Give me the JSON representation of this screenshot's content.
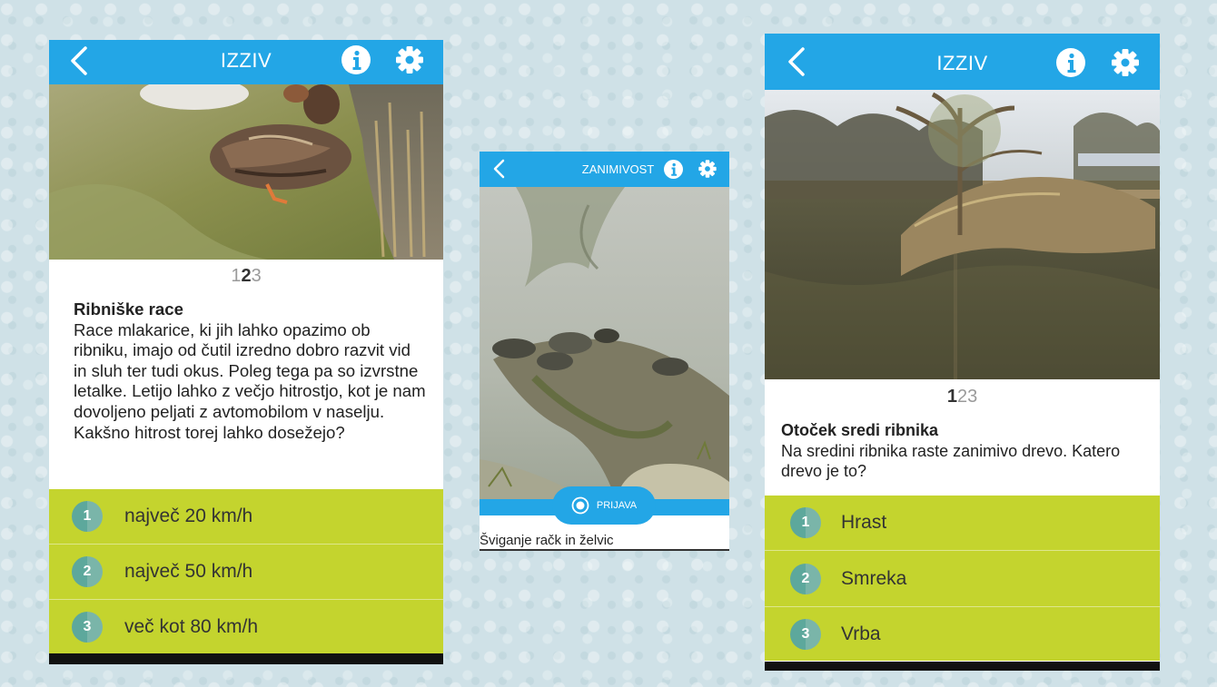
{
  "screens": {
    "left": {
      "header_title": "IZZIV",
      "pager": [
        "1",
        "2",
        "3"
      ],
      "pager_current": "2",
      "description_title": "Ribniške race",
      "description_text": "Race mlakarice, ki jih lahko opazimo ob ribniku, imajo od čutil izredno dobro razvit vid in sluh ter tudi okus. Poleg tega pa so izvrstne letalke. Letijo lahko z večjo hitrostjo, kot je nam dovoljeno peljati z avtomobilom v naselju. Kakšno hitrost torej lahko dosežejo?",
      "answers": [
        {
          "num": "1",
          "label": "največ 20 km/h"
        },
        {
          "num": "2",
          "label": "največ 50 km/h"
        },
        {
          "num": "3",
          "label": "več kot 80 km/h"
        }
      ]
    },
    "middle": {
      "header_title": "ZANIMIVOST",
      "checkin_label": "PRIJAVA",
      "caption": "Švigan​je račk in želvic"
    },
    "right": {
      "header_title": "IZZIV",
      "pager": [
        "1",
        "2",
        "3"
      ],
      "pager_current": "1",
      "description_title": "Otoček sredi ribnika",
      "description_text": "Na sredini ribnika raste zanimivo drevo. Katero drevo je to?",
      "answers": [
        {
          "num": "1",
          "label": "Hrast"
        },
        {
          "num": "2",
          "label": "Smreka"
        },
        {
          "num": "3",
          "label": "Vrba"
        }
      ]
    }
  },
  "colors": {
    "header": "#23a6e6",
    "answers_bg": "#c4d42e",
    "number_badge": "#5da89c",
    "background": "#cfe1e7"
  },
  "icons": [
    "back-arrow-icon",
    "info-icon",
    "gear-icon",
    "checkin-target-icon"
  ]
}
